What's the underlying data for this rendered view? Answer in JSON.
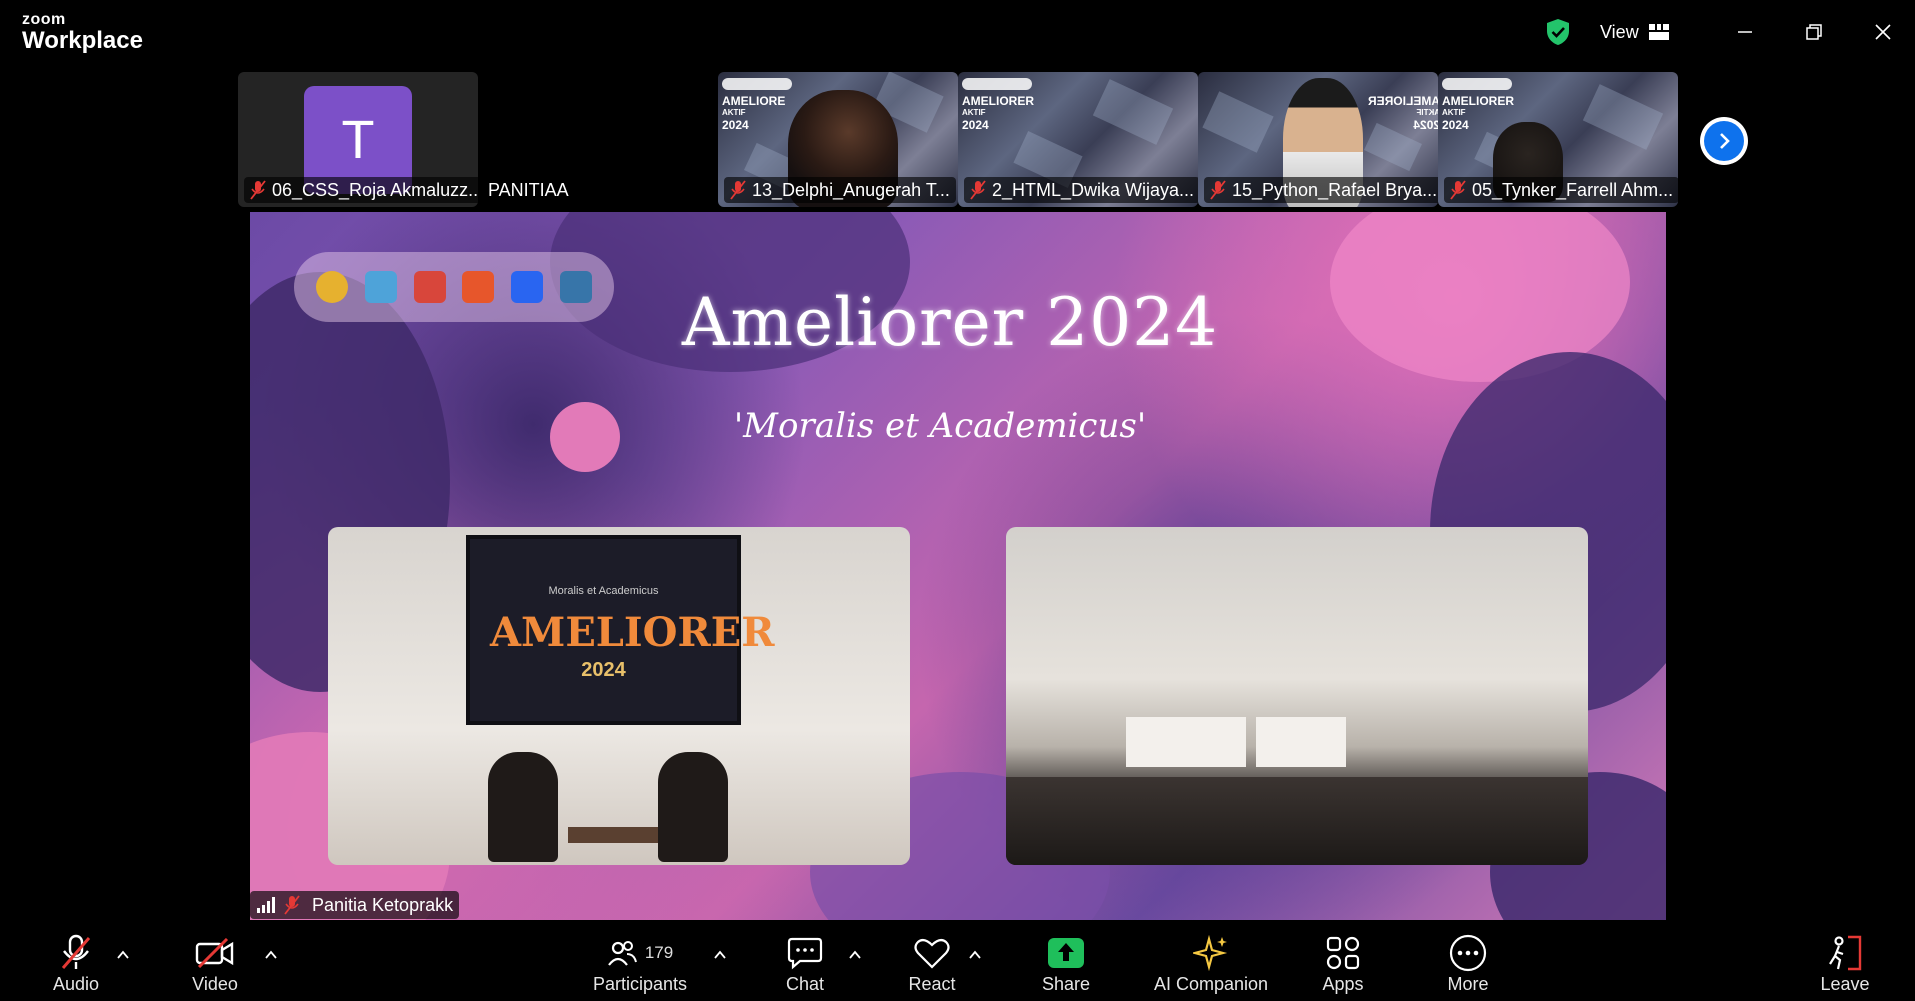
{
  "app": {
    "brand_small": "zoom",
    "brand_large": "Workplace",
    "view_label": "View"
  },
  "colors": {
    "accent": "#0e72ed",
    "shield": "#23c46b",
    "share": "#1fbf5b",
    "mute_red": "#e53935"
  },
  "gallery": [
    {
      "name": "06_CSS_Roja Akmaluzz...",
      "avatar_letter": "T",
      "muted": true
    },
    {
      "name": "PANITIAA",
      "muted": false
    },
    {
      "name": "13_Delphi_Anugerah T...",
      "muted": true,
      "brand_line1": "AMELIORE",
      "brand_line2": "AKTIF",
      "brand_line3": "2024"
    },
    {
      "name": "2_HTML_Dwika Wijaya...",
      "muted": true,
      "brand_line1": "AMELIORER",
      "brand_line2": "AKTIF",
      "brand_line3": "2024"
    },
    {
      "name": "15_Python_Rafael Brya...",
      "muted": true,
      "brand_line1": "AMELIORER",
      "brand_line2": "AKTIF",
      "brand_line3": "2024"
    },
    {
      "name": "05_Tynker_Farrell Ahm...",
      "muted": true,
      "brand_line1": "AMELIORER",
      "brand_line2": "AKTIF",
      "brand_line3": "2024"
    }
  ],
  "slide": {
    "title": "Ameliorer 2024",
    "subtitle": "'Moralis et Academicus'",
    "banner_small": "Moralis et Academicus",
    "banner_title": "AMELIORER",
    "banner_year": "2024"
  },
  "presenter": {
    "name": "Panitia Ketoprakk"
  },
  "toolbar": {
    "audio": "Audio",
    "video": "Video",
    "participants": "Participants",
    "participants_count": "179",
    "chat": "Chat",
    "react": "React",
    "share": "Share",
    "ai_companion": "AI Companion",
    "apps": "Apps",
    "more": "More",
    "leave": "Leave"
  }
}
